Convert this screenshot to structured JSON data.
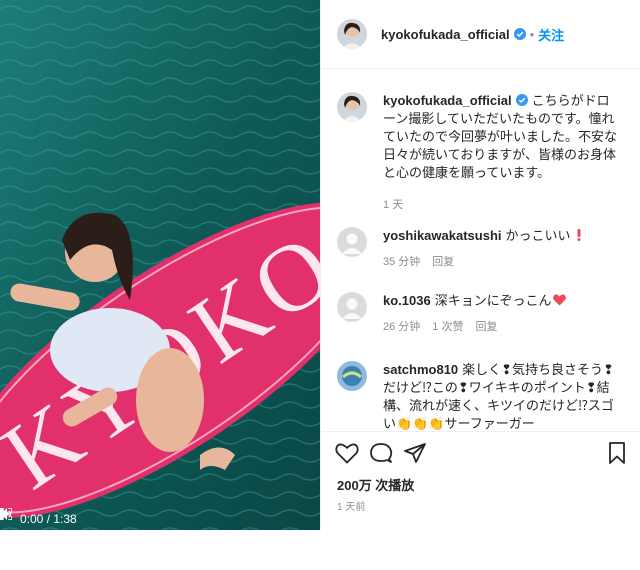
{
  "media": {
    "board_text": "KYOKO",
    "time": "0:00 / 1:38"
  },
  "header": {
    "username": "kyokofukada_official",
    "separator": "•",
    "follow_label": "关注"
  },
  "caption": {
    "username": "kyokofukada_official",
    "text": "こちらがドローン撮影していただいたものです。憧れていたので今回夢が叶いました。不安な日々が続いておりますが、皆様のお身体と心の健康を願っています。",
    "time": "1 天"
  },
  "comments": [
    {
      "username": "yoshikawakatsushi",
      "text": "かっこいい",
      "time": "35 分钟",
      "likes": "",
      "reply_label": "回复"
    },
    {
      "username": "ko.1036",
      "text": "深キョンにぞっこん",
      "time": "26 分钟",
      "likes": "1 次赞",
      "reply_label": "回复"
    },
    {
      "username": "satchmo810",
      "text": "楽しく❢気持ち良さそう❢だけど⁉この❢ワイキキのポイント❢結構、流れが速く、キツイのだけど⁉スゴい👏👏👏サーファーガー",
      "time": "",
      "likes": "",
      "reply_label": ""
    }
  ],
  "footer": {
    "views": "200万 次播放",
    "date": "1 天前"
  },
  "colors": {
    "accent": "#0095f6",
    "verified": "#3897f0",
    "heart": "#ed4956",
    "board": "#e2306c",
    "water": "#0f5f5a"
  }
}
